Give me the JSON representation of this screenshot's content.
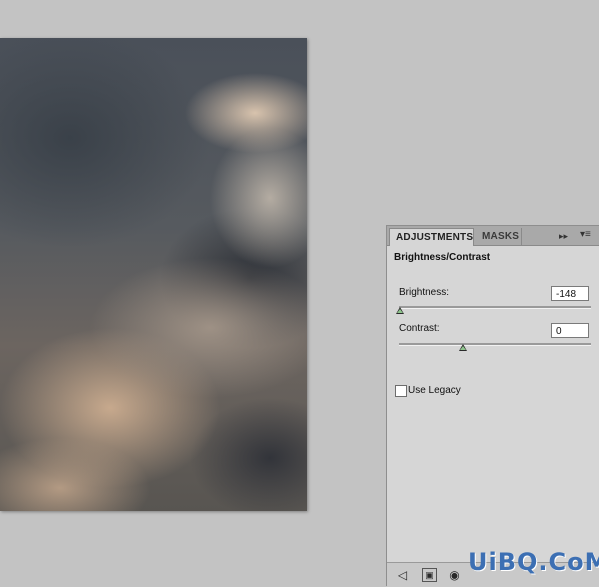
{
  "panel": {
    "tabs": [
      {
        "label": "ADJUSTMENTS"
      },
      {
        "label": "MASKS"
      }
    ],
    "collapse_glyph": "▸▸",
    "menu_glyph": "▾≡",
    "title": "Brightness/Contrast",
    "brightness": {
      "label": "Brightness:",
      "value": "-148",
      "range": [
        -150,
        150
      ]
    },
    "contrast": {
      "label": "Contrast:",
      "value": "0",
      "range": [
        -50,
        100
      ]
    },
    "use_legacy": {
      "label": "Use Legacy",
      "checked": false
    },
    "bottom_icons": [
      "back-arrow-icon",
      "view-previous-icon",
      "clip-to-layer-icon"
    ]
  },
  "watermark": {
    "text": "UiBQ.CoM"
  },
  "colors": {
    "slider_thumb": "#8ec48c",
    "panel_bg": "#d6d6d6",
    "workspace_bg": "#c3c3c3"
  }
}
